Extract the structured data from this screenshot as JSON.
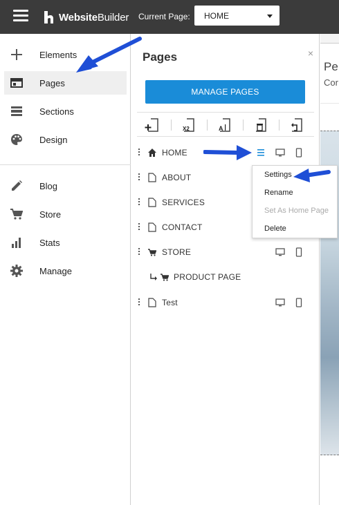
{
  "topbar": {
    "logo_prefix": "Website",
    "logo_suffix": "Builder",
    "current_page_label": "Current Page:",
    "current_page_value": "HOME"
  },
  "leftnav": {
    "items": [
      {
        "label": "Elements",
        "icon": "plus-icon"
      },
      {
        "label": "Pages",
        "icon": "pages-icon"
      },
      {
        "label": "Sections",
        "icon": "sections-icon"
      },
      {
        "label": "Design",
        "icon": "palette-icon"
      },
      {
        "label": "Blog",
        "icon": "pencil-icon"
      },
      {
        "label": "Store",
        "icon": "cart-icon"
      },
      {
        "label": "Stats",
        "icon": "bar-chart-icon"
      },
      {
        "label": "Manage",
        "icon": "gear-icon"
      }
    ]
  },
  "panel": {
    "title": "Pages",
    "close": "×",
    "manage_button": "MANAGE PAGES",
    "tools": [
      "add-page-icon",
      "duplicate-page-icon",
      "rename-page-icon",
      "delete-page-icon",
      "undo-page-icon"
    ],
    "tool_labels": {
      "duplicate": "X2",
      "rename": "A"
    },
    "pages": [
      {
        "name": "HOME",
        "icon": "home-icon",
        "sub": false
      },
      {
        "name": "ABOUT",
        "icon": "page-icon",
        "sub": false
      },
      {
        "name": "SERVICES",
        "icon": "page-icon",
        "sub": false
      },
      {
        "name": "CONTACT",
        "icon": "page-icon",
        "sub": false
      },
      {
        "name": "STORE",
        "icon": "cart-icon",
        "sub": false
      },
      {
        "name": "PRODUCT PAGE",
        "icon": "cart-icon",
        "sub": true
      },
      {
        "name": "Test",
        "icon": "page-icon",
        "sub": false
      }
    ]
  },
  "menu": {
    "items": [
      {
        "label": "Settings",
        "disabled": false
      },
      {
        "label": "Rename",
        "disabled": false
      },
      {
        "label": "Set As Home Page",
        "disabled": true
      },
      {
        "label": "Delete",
        "disabled": false
      }
    ]
  },
  "preview": {
    "line1": "Pe",
    "line2": "Cor"
  },
  "colors": {
    "topbar": "#3b3b3b",
    "accent": "#1a8cd8",
    "arrow": "#1f4fd6"
  }
}
